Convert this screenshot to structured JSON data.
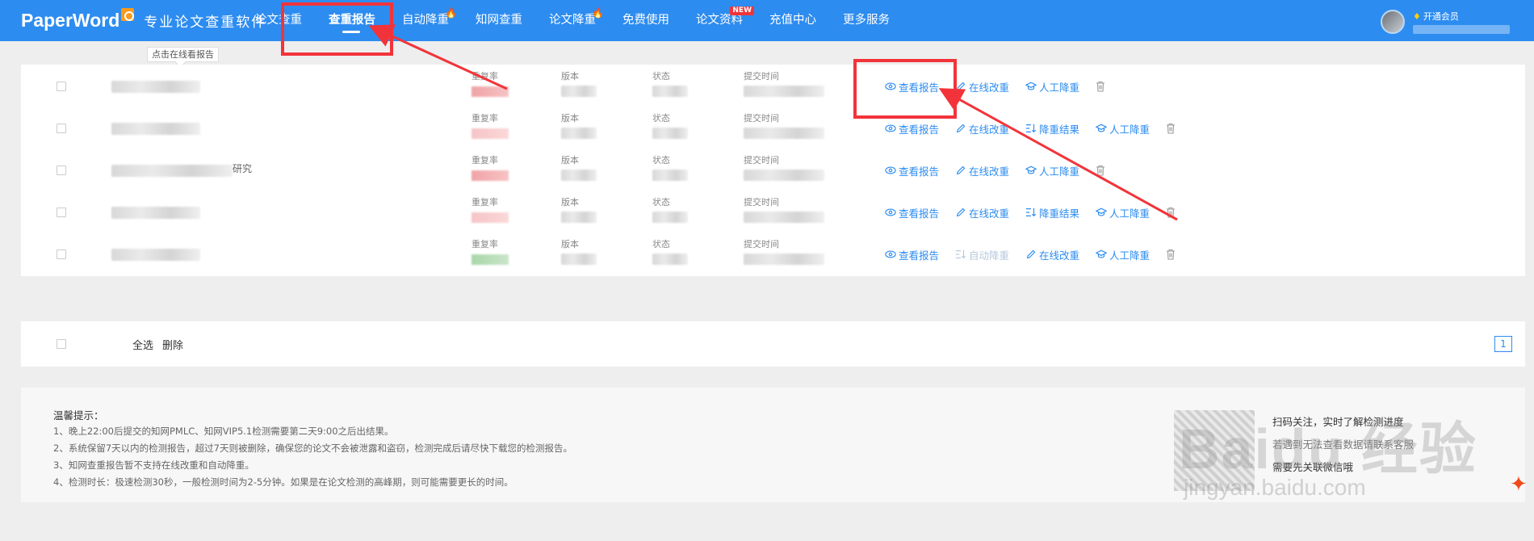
{
  "brand": {
    "logo": "PaperWord",
    "slogan": "专业论文查重软件"
  },
  "nav": [
    {
      "label": "论文查重",
      "active": false,
      "flame": false,
      "new": false
    },
    {
      "label": "查重报告",
      "active": true,
      "flame": false,
      "new": false
    },
    {
      "label": "自动降重",
      "active": false,
      "flame": true,
      "new": false
    },
    {
      "label": "知网查重",
      "active": false,
      "flame": false,
      "new": false
    },
    {
      "label": "论文降重",
      "active": false,
      "flame": true,
      "new": false
    },
    {
      "label": "免费使用",
      "active": false,
      "flame": false,
      "new": false
    },
    {
      "label": "论文资料",
      "active": false,
      "flame": false,
      "new": true
    },
    {
      "label": "充值中心",
      "active": false,
      "flame": false,
      "new": false
    },
    {
      "label": "更多服务",
      "active": false,
      "flame": false,
      "new": false
    }
  ],
  "nav_new_badge": "NEW",
  "user": {
    "vip_label": "开通会员",
    "vip_icon": "diamond-icon"
  },
  "tooltip": "点击在线看报告",
  "field_labels": {
    "rate": "重复率",
    "version": "版本",
    "status": "状态",
    "time": "提交时间"
  },
  "actions": {
    "view": "查看报告",
    "edit": "在线改重",
    "result": "降重结果",
    "auto": "自动降重",
    "manual": "人工降重"
  },
  "rows": [
    {
      "rate_color": "red",
      "actions": [
        "view",
        "edit",
        "manual",
        "trash"
      ],
      "title_suffix": ""
    },
    {
      "rate_color": "red2",
      "actions": [
        "view",
        "edit",
        "result",
        "manual",
        "trash"
      ],
      "title_suffix": ""
    },
    {
      "rate_color": "red",
      "actions": [
        "view",
        "edit",
        "manual",
        "trash"
      ],
      "title_suffix": "研究"
    },
    {
      "rate_color": "red2",
      "actions": [
        "view",
        "edit",
        "result",
        "manual",
        "trash"
      ],
      "title_suffix": ""
    },
    {
      "rate_color": "green",
      "actions": [
        "view",
        "auto",
        "edit",
        "manual",
        "trash"
      ],
      "title_suffix": ""
    }
  ],
  "footer": {
    "select_all": "全选",
    "delete": "删除",
    "page": "1"
  },
  "tips": {
    "title": "温馨提示：",
    "lines": [
      "1、晚上22:00后提交的知网PMLC、知网VIP5.1检测需要第二天9:00之后出结果。",
      "2、系统保留7天以内的检测报告，超过7天则被删除，确保您的论文不会被泄露和盗窃，检测完成后请尽快下载您的检测报告。",
      "3、知网查重报告暂不支持在线改重和自动降重。",
      "4、检测时长：极速检测30秒，一般检测时间为2-5分钟。如果是在论文检测的高峰期，则可能需要更长的时间。"
    ]
  },
  "qr": {
    "line1": "扫码关注，实时了解检测进度",
    "line2": "若遇到无法查看数据请联系客服",
    "line3": "需要先关联微信哦"
  },
  "watermark": {
    "main": "Baidu 经验",
    "sub": "jingyan.baidu.com"
  },
  "colors": {
    "header": "#2d8cf0",
    "link": "#2d8cf0",
    "annotation": "#f2343a"
  }
}
